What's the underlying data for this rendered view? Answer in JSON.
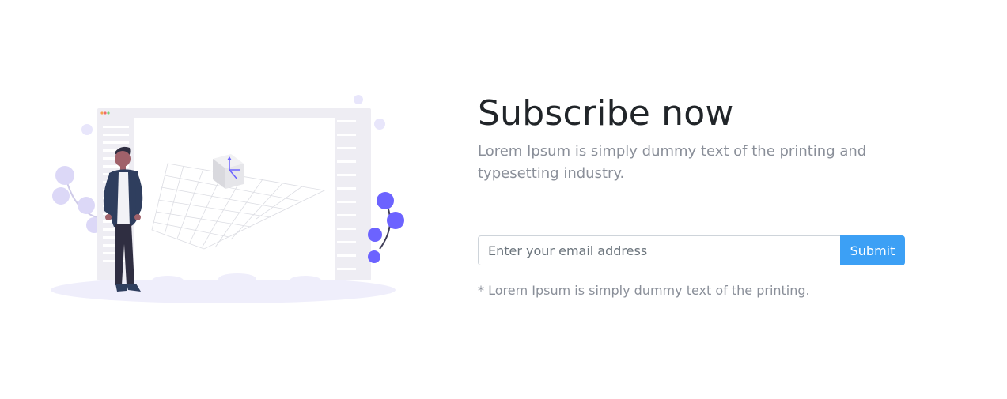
{
  "subscribe": {
    "title": "Subscribe now",
    "description": "Lorem Ipsum is simply dummy text of the printing and typesetting industry.",
    "email_placeholder": "Enter your email address",
    "submit_label": "Submit",
    "note": "* Lorem Ipsum is simply dummy text of the printing."
  },
  "colors": {
    "title": "#212529",
    "muted_text": "#8a8f99",
    "button": "#3ca0f5",
    "accent_purple": "#6c63ff",
    "illustration_bg": "#eeedf6"
  }
}
